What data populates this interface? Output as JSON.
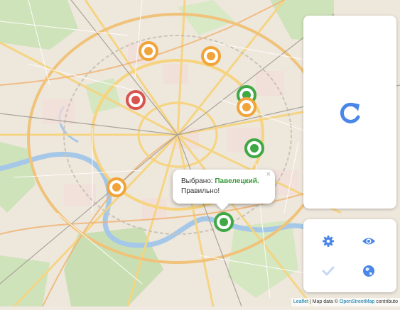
{
  "map": {
    "colors": {
      "ring": "#ccc7bc",
      "road": "#f6d47f",
      "highway": "#f0b16e",
      "park": "#c9dfb3",
      "water": "#a6c8e8"
    }
  },
  "markers": [
    {
      "id": "orange-1",
      "color": "#f0a43a"
    },
    {
      "id": "orange-2",
      "color": "#f0a43a"
    },
    {
      "id": "red-1",
      "color": "#d9534f"
    },
    {
      "id": "green-1",
      "color": "#3fa845"
    },
    {
      "id": "orange-3",
      "color": "#f0a43a"
    },
    {
      "id": "green-2",
      "color": "#3fa845"
    },
    {
      "id": "orange-4",
      "color": "#f0a43a"
    },
    {
      "id": "green-3",
      "color": "#3fa845"
    }
  ],
  "popup": {
    "selected_label": "Выбрано:",
    "station": "Павелецкий.",
    "result": "Правильно!",
    "close": "×"
  },
  "controls": {
    "refresh_icon": "refresh-icon",
    "settings_icon": "gear-icon",
    "view_icon": "eye-icon",
    "check_icon": "check-icon",
    "globe_icon": "globe-icon",
    "accent": "#4a86e8"
  },
  "attribution": {
    "leaflet": "Leaflet",
    "separator": " | Map data © ",
    "osm": "OpenStreetMap",
    "suffix": " contributo"
  }
}
